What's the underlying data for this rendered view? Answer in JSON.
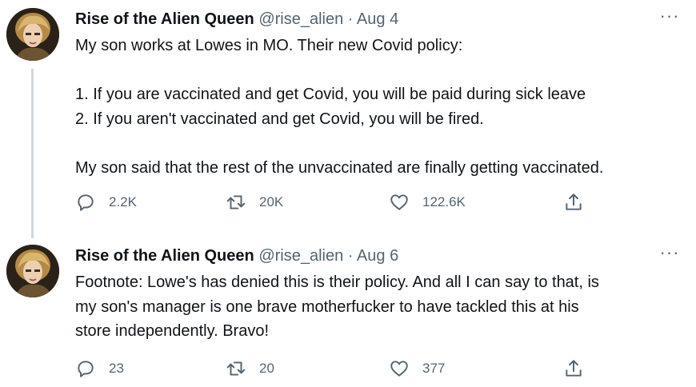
{
  "tweets": [
    {
      "author_name": "Rise of the Alien Queen",
      "handle": "@rise_alien",
      "separator": "·",
      "date": "Aug 4",
      "more_label": "···",
      "body_lines": [
        "My son works at Lowes in MO. Their new Covid policy:",
        "",
        "1. If you are vaccinated and get Covid, you will be paid during sick leave",
        "2. If you aren't vaccinated and get Covid, you will be fired.",
        "",
        "My son said that the rest of the unvaccinated are finally getting vaccinated."
      ],
      "replies": "2.2K",
      "retweets": "20K",
      "likes": "122.6K"
    },
    {
      "author_name": "Rise of the Alien Queen",
      "handle": "@rise_alien",
      "separator": "·",
      "date": "Aug 6",
      "more_label": "···",
      "body_lines": [
        "Footnote: Lowe's has denied this is their policy. And all I can say to that, is",
        "my son's manager is one brave motherfucker to have tackled this at his",
        "store independently. Bravo!"
      ],
      "replies": "23",
      "retweets": "20",
      "likes": "377"
    }
  ],
  "icons": {
    "reply": "reply-icon",
    "retweet": "retweet-icon",
    "like": "heart-icon",
    "share": "share-icon",
    "more": "more-icon"
  },
  "colors": {
    "text": "#0f1419",
    "secondary": "#536471",
    "thread_line": "#cfd9de",
    "background": "#ffffff"
  }
}
